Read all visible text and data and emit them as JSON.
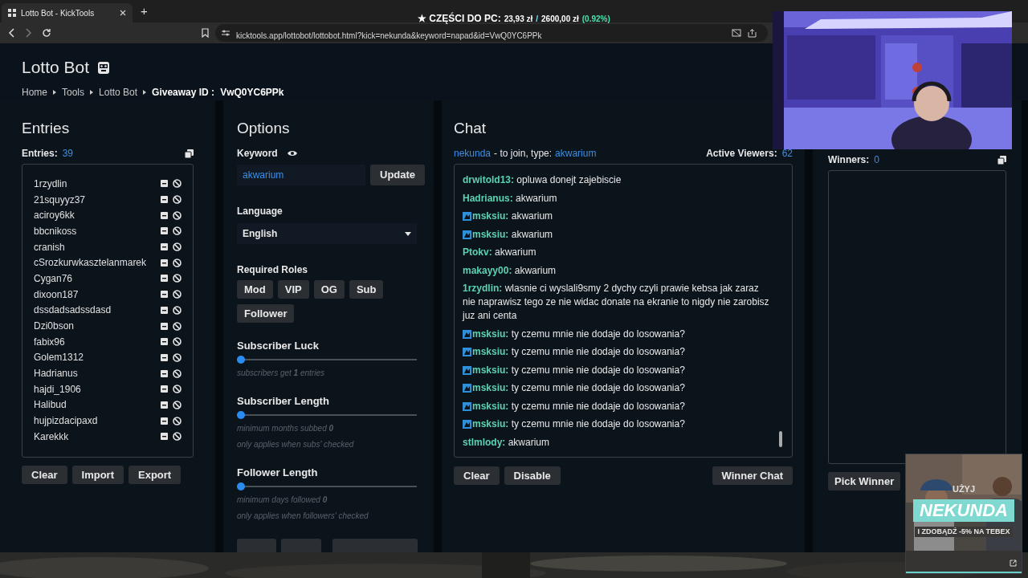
{
  "browser": {
    "tab_title": "Lotto Bot - KickTools",
    "new_tab": "+",
    "url": "kicktools.app/lottobot/lottobot.html?kick=nekunda&keyword=napad&id=VwQ0YC6PPk"
  },
  "stream_overlay": {
    "goal_label": "★ CZĘŚCI DO PC:",
    "goal_current": "23,93 zł",
    "separator": "/",
    "goal_target": "2600,00 zł",
    "goal_percent": "(0.92%)"
  },
  "page": {
    "title": "Lotto Bot",
    "breadcrumbs": [
      "Home",
      "Tools",
      "Lotto Bot"
    ],
    "current_label": "Giveaway ID :",
    "giveaway_id": "VwQ0YC6PPk"
  },
  "entries": {
    "heading": "Entries",
    "count_label": "Entries:",
    "count": "39",
    "items": [
      "1rzydlin",
      "21squyyz37",
      "aciroy6kk",
      "bbcnikoss",
      "cranish",
      "cSrozkurwkasztelanmarek",
      "Cygan76",
      "dixoon187",
      "dssdadsadssdasd",
      "Dzi0bson",
      "fabix96",
      "Golem1312",
      "Hadrianus",
      "hajdi_1906",
      "Halibud",
      "hujpizdacipaxd",
      "Karekkk"
    ],
    "buttons": [
      "Clear",
      "Import",
      "Export"
    ]
  },
  "options": {
    "heading": "Options",
    "keyword": {
      "label": "Keyword",
      "value": "akwarium",
      "button": "Update"
    },
    "language": {
      "label": "Language",
      "value": "English"
    },
    "roles": {
      "label": "Required Roles",
      "items": [
        "Mod",
        "VIP",
        "OG",
        "Sub",
        "Follower"
      ]
    },
    "sliders": [
      {
        "label": "Subscriber Luck",
        "level": 0,
        "hints": [
          "subscribers get **1** entries"
        ]
      },
      {
        "label": "Subscriber Length",
        "level": 0,
        "hints": [
          "minimum months subbed **0**",
          "only applies when subs' checked"
        ]
      },
      {
        "label": "Follower Length",
        "level": 0,
        "hints": [
          "minimum days followed **0**",
          "only applies when followers' checked"
        ]
      }
    ]
  },
  "chat": {
    "heading": "Chat",
    "channel": "nekunda",
    "join_text": "- to join, type:",
    "keyword": "akwarium",
    "viewers_label": "Active Viewers:",
    "viewers_count": "62",
    "messages": [
      {
        "user": "drwitold13:",
        "text": "opluwa donejt zajebiscie",
        "badge": false
      },
      {
        "user": "Hadrianus:",
        "text": "akwarium",
        "badge": false
      },
      {
        "user": "msksiu:",
        "text": "akwarium",
        "badge": true
      },
      {
        "user": "msksiu:",
        "text": "akwarium",
        "badge": true
      },
      {
        "user": "Ptokv:",
        "text": "akwarium",
        "badge": false
      },
      {
        "user": "makayy00:",
        "text": "akwarium",
        "badge": false
      },
      {
        "user": "1rzydlin:",
        "text": "wlasnie ci wyslali9smy 2 dychy czyli prawie kebsa jak zaraz nie naprawisz tego ze nie widac donate na ekranie to nigdy nie zarobisz juz ani centa",
        "badge": false
      },
      {
        "user": "msksiu:",
        "text": "ty czemu mnie nie dodaje do losowania?",
        "badge": true
      },
      {
        "user": "msksiu:",
        "text": "ty czemu mnie nie dodaje do losowania?",
        "badge": true
      },
      {
        "user": "msksiu:",
        "text": "ty czemu mnie nie dodaje do losowania?",
        "badge": true
      },
      {
        "user": "msksiu:",
        "text": "ty czemu mnie nie dodaje do losowania?",
        "badge": true
      },
      {
        "user": "msksiu:",
        "text": "ty czemu mnie nie dodaje do losowania?",
        "badge": true
      },
      {
        "user": "msksiu:",
        "text": "ty czemu mnie nie dodaje do losowania?",
        "badge": true
      },
      {
        "user": "stlmlody:",
        "text": "akwarium",
        "badge": false
      }
    ],
    "buttons": [
      "Clear",
      "Disable"
    ],
    "winner_button": "Winner Chat"
  },
  "winners": {
    "count_label": "Winners:",
    "count": "0",
    "button": "Pick Winner"
  },
  "ad": {
    "line_1": "UŻYJ",
    "code": "NEKUNDA",
    "line_2": "I ZDOBĄDŹ -5% NA TEBEX"
  }
}
